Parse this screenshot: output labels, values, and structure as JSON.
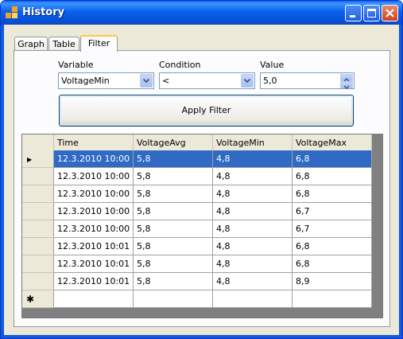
{
  "window": {
    "title": "History"
  },
  "tabs": [
    {
      "label": "Graph"
    },
    {
      "label": "Table"
    },
    {
      "label": "Filter",
      "active": true
    }
  ],
  "filter": {
    "variable_label": "Variable",
    "variable_value": "VoltageMin",
    "condition_label": "Condition",
    "condition_value": "<",
    "value_label": "Value",
    "value_value": "5,0",
    "apply_label": "Apply Filter"
  },
  "table": {
    "columns": [
      "Time",
      "VoltageAvg",
      "VoltageMin",
      "VoltageMax"
    ],
    "rows": [
      [
        "12.3.2010 10:00",
        "5,8",
        "4,8",
        "6,8"
      ],
      [
        "12.3.2010 10:00",
        "5,8",
        "4,8",
        "6,8"
      ],
      [
        "12.3.2010 10:00",
        "5,8",
        "4,8",
        "6,8"
      ],
      [
        "12.3.2010 10:00",
        "5,8",
        "4,8",
        "6,7"
      ],
      [
        "12.3.2010 10:00",
        "5,8",
        "4,8",
        "6,7"
      ],
      [
        "12.3.2010 10:01",
        "5,8",
        "4,8",
        "6,8"
      ],
      [
        "12.3.2010 10:01",
        "5,8",
        "4,8",
        "6,8"
      ],
      [
        "12.3.2010 10:01",
        "5,8",
        "4,8",
        "8,9"
      ]
    ],
    "selected_row": 0,
    "current_row_marker": "▶",
    "new_row_marker": "✱"
  },
  "colors": {
    "titlebar": "#0b61ea",
    "selection": "#316ac5",
    "grid_background": "#808080",
    "tab_highlight": "#ffc83c"
  },
  "icons": {
    "app": "app-icon",
    "minimize": "minimize-icon",
    "maximize": "maximize-icon",
    "close": "close-icon"
  }
}
